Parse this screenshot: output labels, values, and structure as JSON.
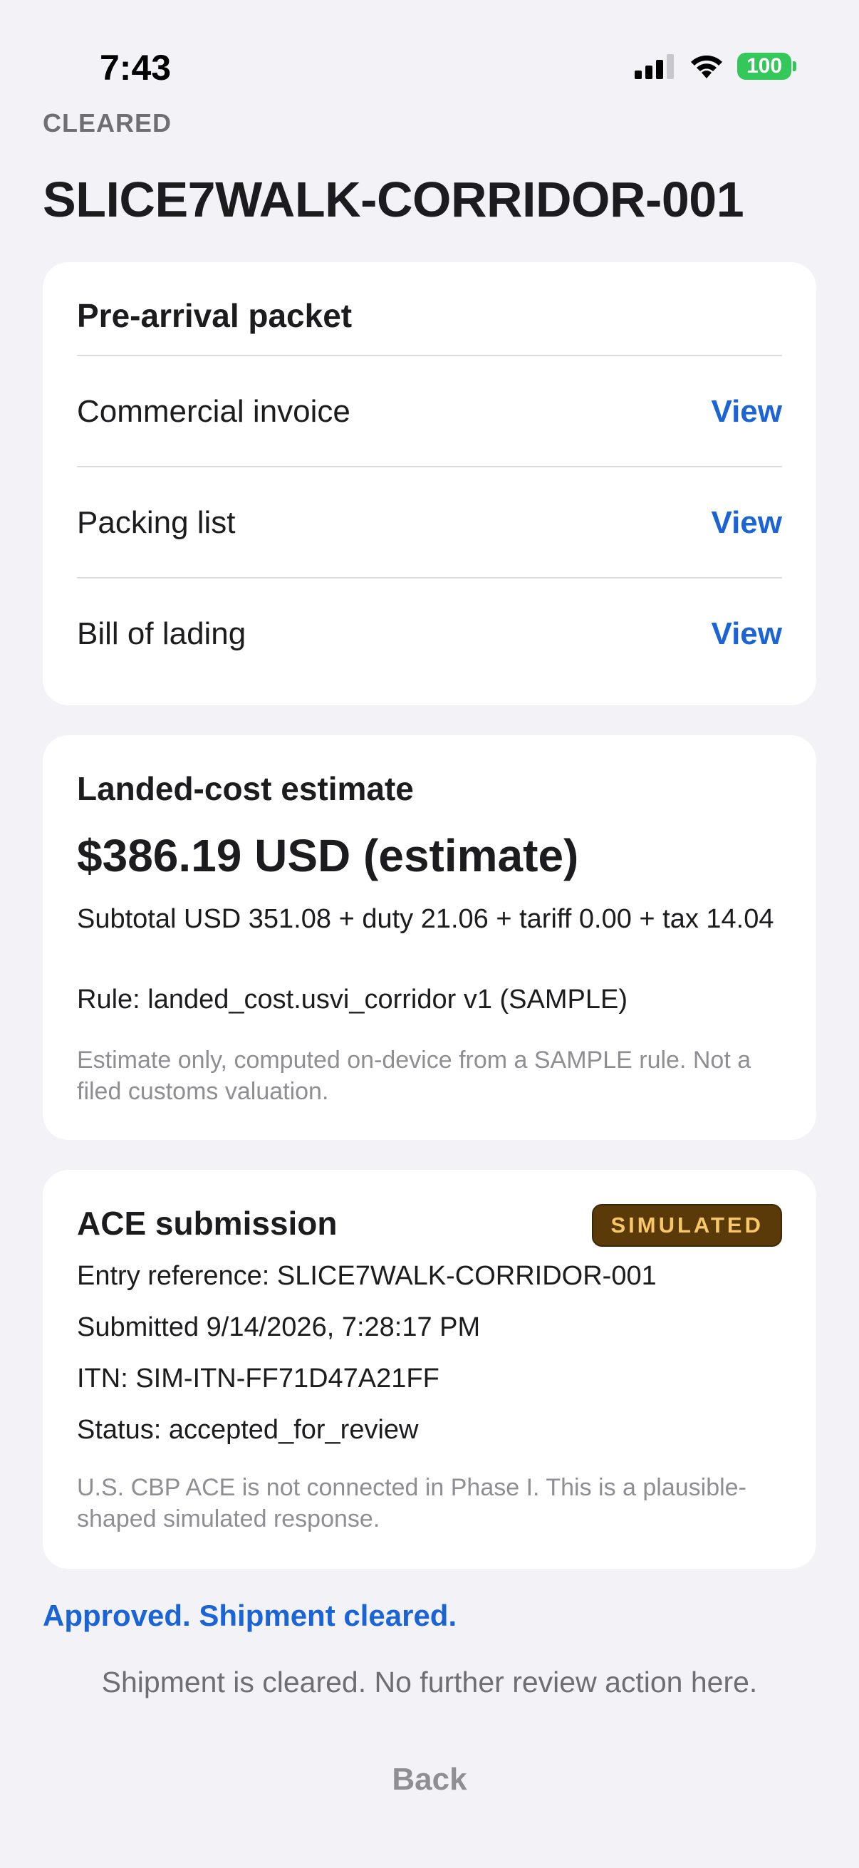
{
  "status_bar": {
    "time": "7:43",
    "battery_level": "100",
    "icons": [
      "cellular-signal-icon",
      "wifi-icon",
      "battery-icon"
    ]
  },
  "header": {
    "status_label": "CLEARED",
    "title": "SLICE7WALK-CORRIDOR-001"
  },
  "packet": {
    "heading": "Pre-arrival packet",
    "documents": [
      {
        "label": "Commercial invoice",
        "action": "View"
      },
      {
        "label": "Packing list",
        "action": "View"
      },
      {
        "label": "Bill of lading",
        "action": "View"
      }
    ]
  },
  "landed_cost": {
    "heading": "Landed-cost estimate",
    "total": "$386.19 USD (estimate)",
    "breakdown": "Subtotal USD 351.08 + duty 21.06 + tariff 0.00 + tax 14.04",
    "rule": "Rule: landed_cost.usvi_corridor v1 (SAMPLE)",
    "note": "Estimate only, computed on-device from a SAMPLE rule. Not a filed customs valuation."
  },
  "ace": {
    "heading": "ACE submission",
    "badge": "SIMULATED",
    "entry_reference": "Entry reference: SLICE7WALK-CORRIDOR-001",
    "submitted": "Submitted 9/14/2026, 7:28:17 PM",
    "itn": "ITN: SIM-ITN-FF71D47A21FF",
    "status": "Status: accepted_for_review",
    "note": "U.S. CBP ACE is not connected in Phase I. This is a plausible-shaped simulated response."
  },
  "result": {
    "approved_message": "Approved. Shipment cleared.",
    "footer_message": "Shipment is cleared. No further review action here.",
    "back_label": "Back"
  },
  "colors": {
    "background": "#f2f2f7",
    "accent_link": "#1a64d6",
    "badge_bg": "#5a3a09",
    "badge_text": "#f7c76a",
    "battery": "#34c759"
  }
}
